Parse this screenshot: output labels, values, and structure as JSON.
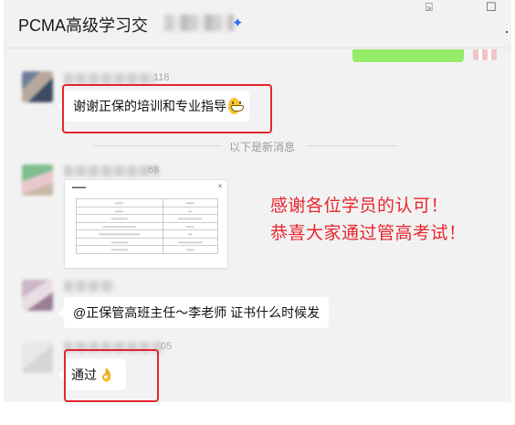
{
  "window": {
    "title": "PCMA高级学习交",
    "controls": {
      "pin": "⍄",
      "maximize": "☐",
      "more": "·"
    }
  },
  "messages": [
    {
      "sender_tail": "118",
      "text": "谢谢正保的培训和专业指导",
      "emoji": "grinning-face-icon"
    },
    {
      "sender_tail": "68"
    },
    {
      "sender_tail": "",
      "text": "@正保管高班主任～李老师 证书什么时候发"
    },
    {
      "sender_tail": "05",
      "text": "通过",
      "emoji": "ok-hand-icon"
    }
  ],
  "divider_text": "以下是新消息",
  "overlay": {
    "line1": "感谢各位学员的认可！",
    "line2": "恭喜大家通过管高考试！"
  },
  "colors": {
    "highlight": "#e3262d",
    "overlay_text": "#e8262d",
    "self_bubble": "#95ec69",
    "chat_bg": "#f2f2f2"
  }
}
